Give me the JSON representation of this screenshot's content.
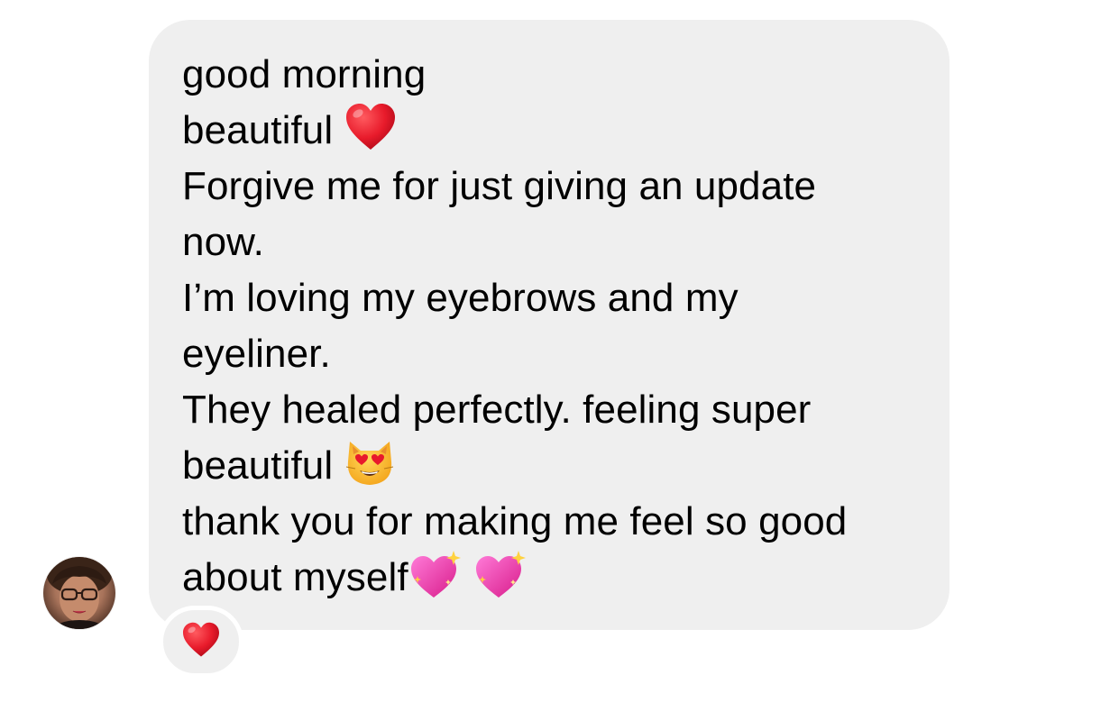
{
  "message": {
    "lines": [
      "good morning",
      "beautiful",
      "Forgive me for just giving an update",
      "now.",
      "I’m loving my eyebrows and my",
      "eyeliner.",
      "They healed perfectly. feeling super",
      "beautiful",
      "thank you for making me feel so good",
      "about myself"
    ],
    "bubble_color": "#efefef",
    "text_color": "#000000"
  },
  "emojis": {
    "line2": "red-heart-icon",
    "line8": "heart-eyes-cat-icon",
    "line10": [
      "sparkling-heart-icon",
      "sparkling-heart-icon"
    ]
  },
  "reaction": {
    "emoji": "red-heart-icon",
    "color": "#e8112d"
  },
  "sender": {
    "avatar": "avatar"
  }
}
